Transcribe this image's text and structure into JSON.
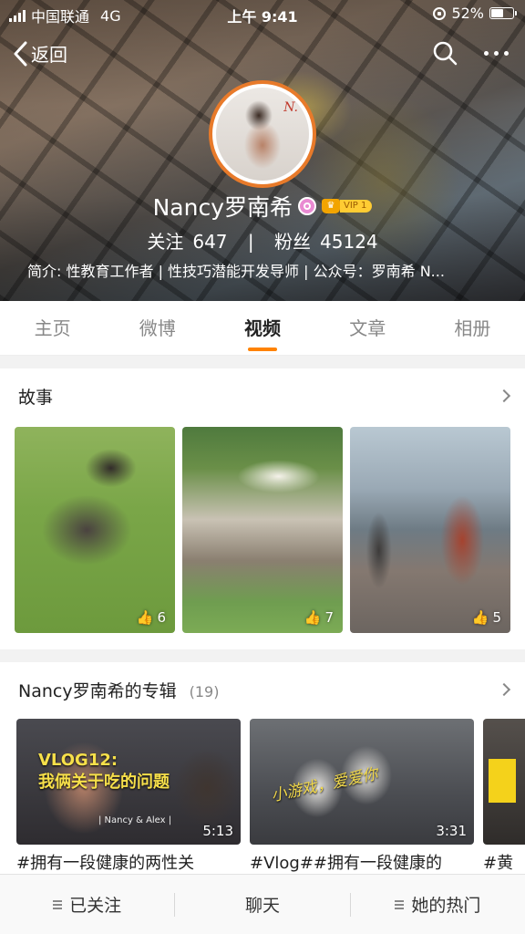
{
  "status_bar": {
    "carrier": "中国联通",
    "network": "4G",
    "time": "上午 9:41",
    "battery": "52%",
    "battery_level": 0.52
  },
  "nav": {
    "back_label": "返回",
    "search_icon": "search-icon",
    "more_icon": "more-icon"
  },
  "profile": {
    "name": "Nancy罗南希",
    "avatar_mark": "N.",
    "vip_label": "VIP 1",
    "follow_label": "关注",
    "follow_count": "647",
    "fans_label": "粉丝",
    "fans_count": "45124",
    "bio": "简介: 性教育工作者 | 性技巧潜能开发导师 | 公众号：罗南希 N..."
  },
  "tabs": [
    {
      "label": "主页",
      "active": false
    },
    {
      "label": "微博",
      "active": false
    },
    {
      "label": "视频",
      "active": true
    },
    {
      "label": "文章",
      "active": false
    },
    {
      "label": "相册",
      "active": false
    }
  ],
  "story": {
    "title": "故事",
    "items": [
      {
        "likes": "6"
      },
      {
        "likes": "7"
      },
      {
        "likes": "5"
      }
    ]
  },
  "album": {
    "title": "Nancy罗南希的专辑",
    "count": "(19)",
    "videos": [
      {
        "title": "#拥有一段健康的两性关",
        "duration": "5:13",
        "overlay": "VLOG12:\n我俩关于吃的问题",
        "overlay_sub": "| Nancy & Alex |"
      },
      {
        "title": "#Vlog##拥有一段健康的",
        "duration": "3:31",
        "overlay": "小游戏，爱爱你"
      },
      {
        "title": "#黄"
      }
    ]
  },
  "bottom_bar": {
    "followed_label": "已关注",
    "chat_label": "聊天",
    "hot_label": "她的热门"
  },
  "colors": {
    "accent": "#ff8200",
    "avatar_ring": "#e87a2a",
    "vip_tag": "#ffcc33"
  }
}
